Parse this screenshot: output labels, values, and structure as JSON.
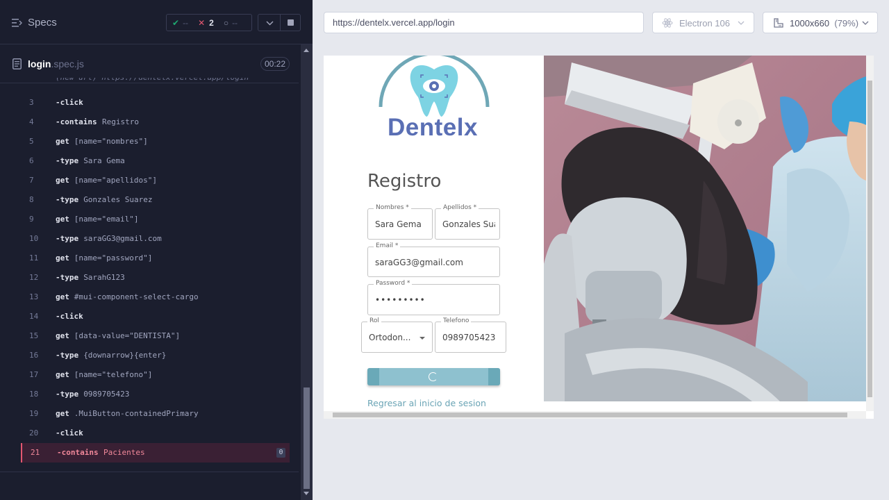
{
  "runner": {
    "specs_label": "Specs",
    "stats": {
      "passed": "--",
      "failed": "2",
      "pending": "--"
    },
    "file": {
      "name": "login",
      "ext": ".spec.js",
      "timer": "00:22"
    },
    "truncated_line": "(new url) https://dentelx.vercel.app/login",
    "commands": [
      {
        "num": "3",
        "name": "-click",
        "arg": ""
      },
      {
        "num": "4",
        "name": "-contains",
        "arg": "Registro"
      },
      {
        "num": "5",
        "name": "get",
        "arg": "[name=\"nombres\"]"
      },
      {
        "num": "6",
        "name": "-type",
        "arg": "Sara Gema"
      },
      {
        "num": "7",
        "name": "get",
        "arg": "[name=\"apellidos\"]"
      },
      {
        "num": "8",
        "name": "-type",
        "arg": "Gonzales Suarez"
      },
      {
        "num": "9",
        "name": "get",
        "arg": "[name=\"email\"]"
      },
      {
        "num": "10",
        "name": "-type",
        "arg": "saraGG3@gmail.com"
      },
      {
        "num": "11",
        "name": "get",
        "arg": "[name=\"password\"]"
      },
      {
        "num": "12",
        "name": "-type",
        "arg": "SarahG123"
      },
      {
        "num": "13",
        "name": "get",
        "arg": "#mui-component-select-cargo"
      },
      {
        "num": "14",
        "name": "-click",
        "arg": ""
      },
      {
        "num": "15",
        "name": "get",
        "arg": "[data-value=\"DENTISTA\"]"
      },
      {
        "num": "16",
        "name": "-type",
        "arg": "{downarrow}{enter}"
      },
      {
        "num": "17",
        "name": "get",
        "arg": "[name=\"telefono\"]"
      },
      {
        "num": "18",
        "name": "-type",
        "arg": "0989705423"
      },
      {
        "num": "19",
        "name": "get",
        "arg": ".MuiButton-containedPrimary"
      },
      {
        "num": "20",
        "name": "-click",
        "arg": ""
      },
      {
        "num": "21",
        "name": "-contains",
        "arg": "Pacientes",
        "badge": "0",
        "failed": true
      }
    ]
  },
  "browser": {
    "url": "https://dentelx.vercel.app/login",
    "engine": "Electron 106",
    "viewport": "1000x660",
    "zoom": "(79%)"
  },
  "app": {
    "logo_text": "Dentelx",
    "title": "Registro",
    "fields": {
      "nombres": {
        "label": "Nombres *",
        "value": "Sara Gema"
      },
      "apellidos": {
        "label": "Apellidos *",
        "value": "Gonzales Suarez"
      },
      "email": {
        "label": "Email *",
        "value": "saraGG3@gmail.com"
      },
      "password": {
        "label": "Password *",
        "value": "•••••••••"
      },
      "rol": {
        "label": "Rol",
        "value": "Ortodon..."
      },
      "telefono": {
        "label": "Telefono",
        "value": "0989705423"
      }
    },
    "back_link": "Regresar al inicio de sesion"
  },
  "colors": {
    "runner_bg": "#1b1e2e",
    "fail": "#e45770",
    "pass": "#1fa971",
    "brand": "#5a6fb4",
    "accent": "#8ec1cf"
  }
}
